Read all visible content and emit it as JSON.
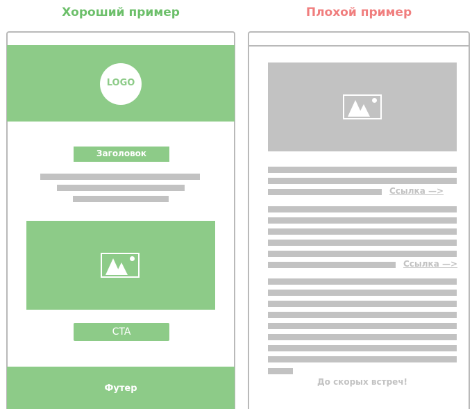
{
  "good": {
    "title": "Хороший пример",
    "title_color": "#6cbf6a",
    "logo": "LOGO",
    "heading": "Заголовок",
    "cta": "CTA",
    "footer": "Футер",
    "accent": "#8dcb88",
    "image_icon": "image-icon"
  },
  "bad": {
    "title": "Плохой пример",
    "title_color": "#f07e7e",
    "links": [
      "Ссылка —>",
      "Ссылка —>"
    ],
    "signoff": "До скорых встреч!",
    "gray": "#c2c2c2",
    "image_icon": "image-icon"
  }
}
